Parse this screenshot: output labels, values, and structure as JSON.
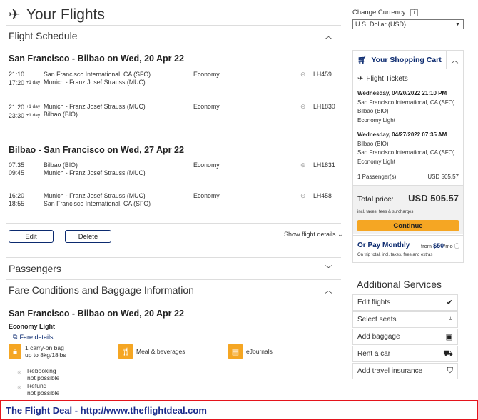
{
  "page_title": "Your Flights",
  "sections": {
    "schedule": "Flight Schedule",
    "passengers": "Passengers",
    "fare": "Fare Conditions and Baggage Information"
  },
  "outbound": {
    "title": "San Francisco - Bilbao on Wed, 20 Apr 22",
    "segments": [
      {
        "dep_time": "21:10",
        "arr_time": "17:20",
        "arr_day": "+1 day",
        "from": "San Francisco International, CA (SFO)",
        "to": "Munich - Franz Josef Strauss (MUC)",
        "cabin": "Economy",
        "flight": "LH459"
      },
      {
        "dep_time": "21:20",
        "dep_day": "+1 day",
        "arr_time": "23:30",
        "arr_day": "+1 day",
        "from": "Munich - Franz Josef Strauss (MUC)",
        "to": "Bilbao (BIO)",
        "cabin": "Economy",
        "flight": "LH1830"
      }
    ]
  },
  "inbound": {
    "title": "Bilbao - San Francisco on Wed, 27 Apr 22",
    "segments": [
      {
        "dep_time": "07:35",
        "arr_time": "09:45",
        "from": "Bilbao (BIO)",
        "to": "Munich - Franz Josef Strauss (MUC)",
        "cabin": "Economy",
        "flight": "LH1831"
      },
      {
        "dep_time": "16:20",
        "arr_time": "18:55",
        "from": "Munich - Franz Josef Strauss (MUC)",
        "to": "San Francisco International, CA (SFO)",
        "cabin": "Economy",
        "flight": "LH458"
      }
    ]
  },
  "actions": {
    "edit": "Edit",
    "delete": "Delete",
    "show_details": "Show flight details"
  },
  "fare": {
    "route": "San Francisco - Bilbao on Wed, 20 Apr 22",
    "fare_name": "Economy Light",
    "fare_details": "Fare details",
    "carry_on_1": "1 carry-on bag",
    "carry_on_2": "up to 8kg/18lbs",
    "meal": "Meal & beverages",
    "journals": "eJournals",
    "rebooking_1": "Rebooking",
    "rebooking_2": "not possible",
    "refund_1": "Refund",
    "refund_2": "not possible"
  },
  "currency": {
    "label": "Change Currency:",
    "selected": "U.S. Dollar (USD)"
  },
  "cart": {
    "title": "Your Shopping Cart",
    "tickets": "Flight Tickets",
    "trip1": {
      "date": "Wednesday, 04/20/2022 21:10 PM",
      "from": "San Francisco International, CA (SFO)",
      "to": "Bilbao (BIO)",
      "fare": "Economy Light"
    },
    "trip2": {
      "date": "Wednesday, 04/27/2022 07:35 AM",
      "from": "Bilbao (BIO)",
      "to": "San Francisco International, CA (SFO)",
      "fare": "Economy Light"
    },
    "passengers": "1 Passenger(s)",
    "pax_price": "USD 505.57",
    "total_label": "Total price:",
    "total_value": "USD 505.57",
    "incl": "incl. taxes, fees & surcharges",
    "continue": "Continue",
    "monthly_title": "Or Pay Monthly",
    "monthly_from": "from",
    "monthly_amount": "$50",
    "monthly_per": "/mo",
    "monthly_note": "On trip total, incl. taxes, fees and extras"
  },
  "additional": {
    "title": "Additional Services",
    "items": [
      {
        "label": "Edit flights",
        "icon": "check-icon"
      },
      {
        "label": "Select seats",
        "icon": "seat-icon"
      },
      {
        "label": "Add baggage",
        "icon": "baggage-icon"
      },
      {
        "label": "Rent a car",
        "icon": "car-icon"
      },
      {
        "label": "Add travel insurance",
        "icon": "shield-icon"
      }
    ]
  },
  "footer": "The Flight Deal - http://www.theflightdeal.com"
}
